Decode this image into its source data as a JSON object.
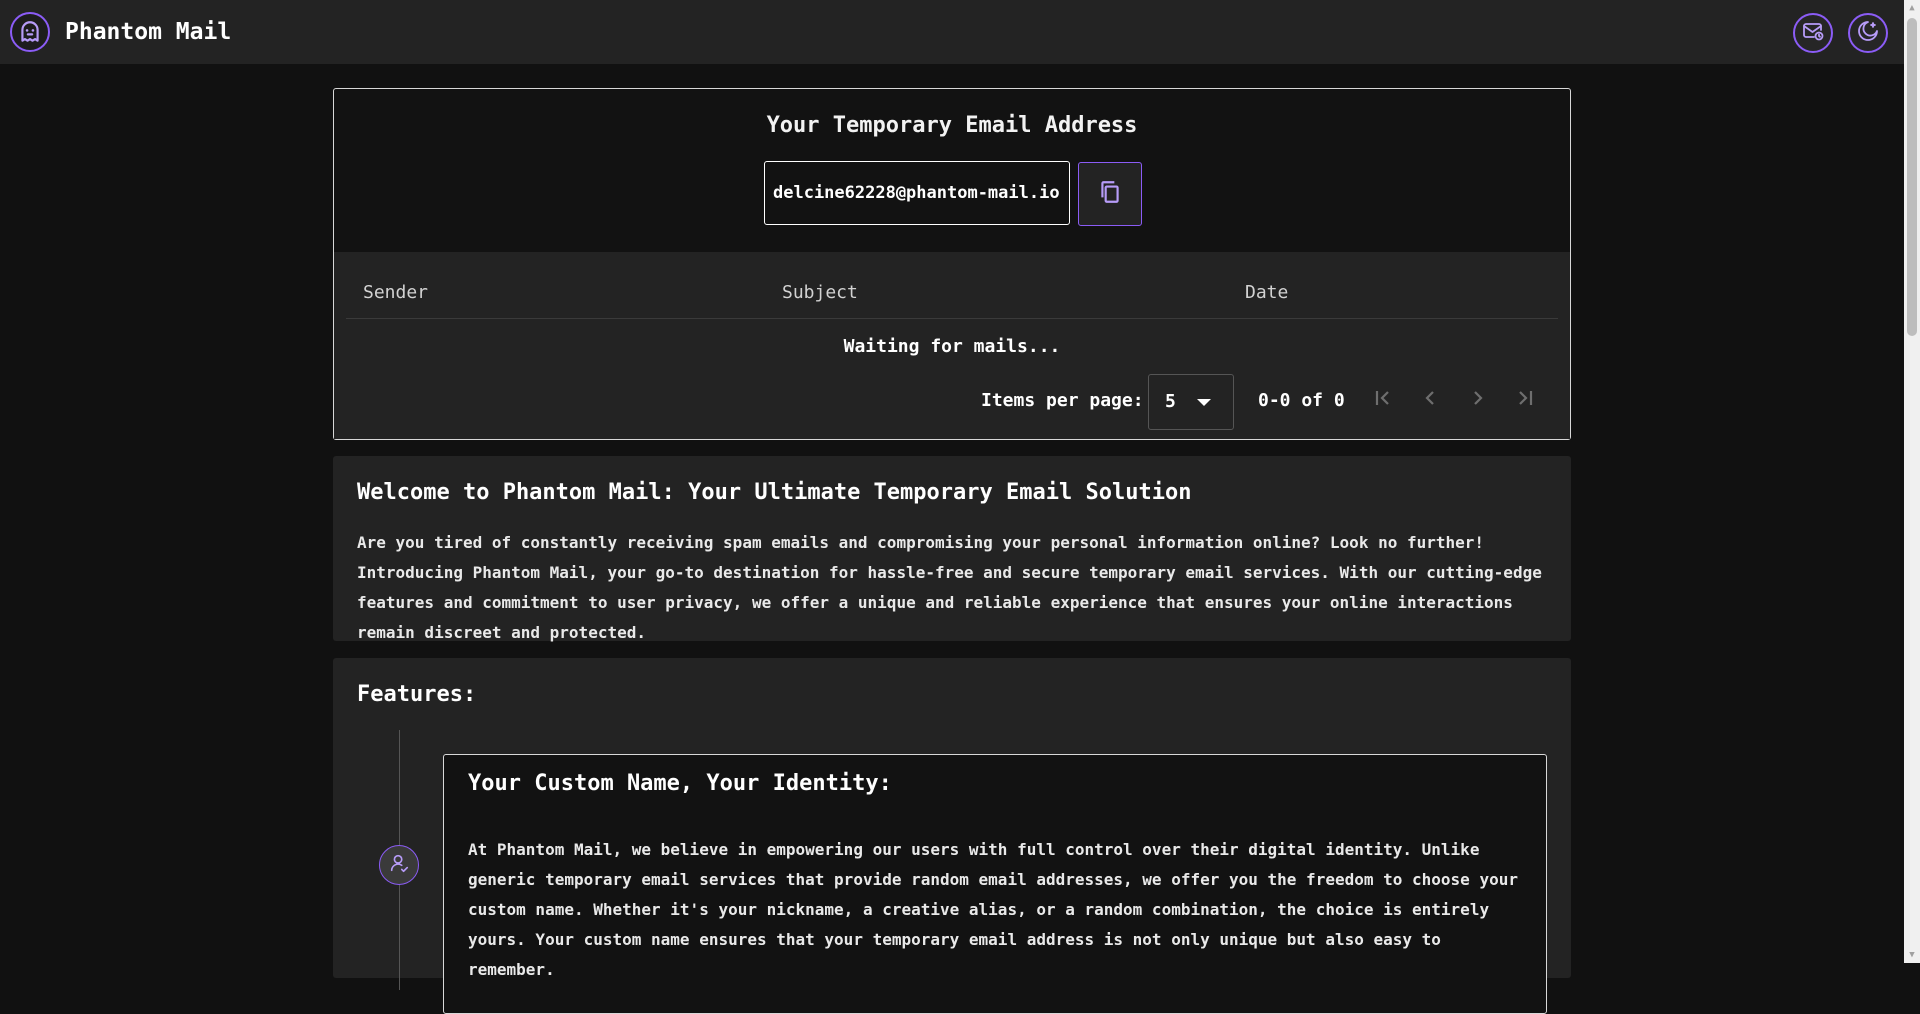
{
  "app": {
    "title": "Phantom Mail",
    "accent": "#8b5cf6"
  },
  "header": {
    "logo_icon": "ghost-icon",
    "mail_icon": "mail-clock-icon",
    "theme_icon": "moon-stars-icon"
  },
  "email_card": {
    "title": "Your Temporary Email Address",
    "address": "delcine62228@phantom-mail.io",
    "copy_icon": "copy-icon"
  },
  "mail_table": {
    "columns": [
      "Sender",
      "Subject",
      "Date"
    ],
    "empty_message": "Waiting for mails...",
    "pagination": {
      "items_per_page_label": "Items per page:",
      "items_per_page": "5",
      "range": "0-0 of 0"
    }
  },
  "welcome": {
    "title": "Welcome to Phantom Mail: Your Ultimate Temporary Email Solution",
    "body": "Are you tired of constantly receiving spam emails and compromising your personal information online? Look no further! Introducing Phantom Mail, your go-to destination for hassle-free and secure temporary email services. With our cutting-edge features and commitment to user privacy, we offer a unique and reliable experience that ensures your online interactions remain discreet and protected."
  },
  "features": {
    "title": "Features:",
    "items": [
      {
        "icon": "user-check-icon",
        "title": "Your Custom Name, Your Identity:",
        "body": "At Phantom Mail, we believe in empowering our users with full control over their digital identity. Unlike generic temporary email services that provide random email addresses, we offer you the freedom to choose your custom name. Whether it's your nickname, a creative alias, or a random combination, the choice is entirely yours. Your custom name ensures that your temporary email address is not only unique but also easy to remember."
      }
    ]
  }
}
